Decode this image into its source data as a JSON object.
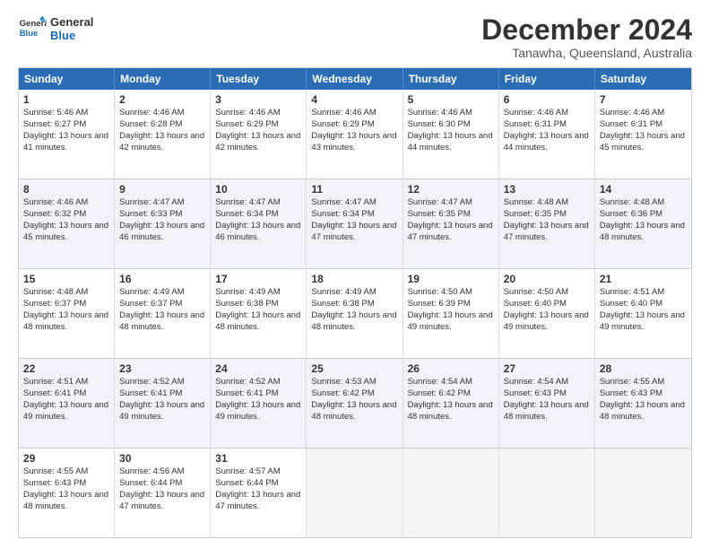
{
  "logo": {
    "line1": "General",
    "line2": "Blue"
  },
  "title": "December 2024",
  "subtitle": "Tanawha, Queensland, Australia",
  "days": [
    "Sunday",
    "Monday",
    "Tuesday",
    "Wednesday",
    "Thursday",
    "Friday",
    "Saturday"
  ],
  "rows": [
    [
      {
        "day": 1,
        "sunrise": "5:46 AM",
        "sunset": "6:27 PM",
        "daylight": "13 hours and 41 minutes."
      },
      {
        "day": 2,
        "sunrise": "4:46 AM",
        "sunset": "6:28 PM",
        "daylight": "13 hours and 42 minutes."
      },
      {
        "day": 3,
        "sunrise": "4:46 AM",
        "sunset": "6:29 PM",
        "daylight": "13 hours and 42 minutes."
      },
      {
        "day": 4,
        "sunrise": "4:46 AM",
        "sunset": "6:29 PM",
        "daylight": "13 hours and 43 minutes."
      },
      {
        "day": 5,
        "sunrise": "4:46 AM",
        "sunset": "6:30 PM",
        "daylight": "13 hours and 44 minutes."
      },
      {
        "day": 6,
        "sunrise": "4:46 AM",
        "sunset": "6:31 PM",
        "daylight": "13 hours and 44 minutes."
      },
      {
        "day": 7,
        "sunrise": "4:46 AM",
        "sunset": "6:31 PM",
        "daylight": "13 hours and 45 minutes."
      }
    ],
    [
      {
        "day": 8,
        "sunrise": "4:46 AM",
        "sunset": "6:32 PM",
        "daylight": "13 hours and 45 minutes."
      },
      {
        "day": 9,
        "sunrise": "4:47 AM",
        "sunset": "6:33 PM",
        "daylight": "13 hours and 46 minutes."
      },
      {
        "day": 10,
        "sunrise": "4:47 AM",
        "sunset": "6:34 PM",
        "daylight": "13 hours and 46 minutes."
      },
      {
        "day": 11,
        "sunrise": "4:47 AM",
        "sunset": "6:34 PM",
        "daylight": "13 hours and 47 minutes."
      },
      {
        "day": 12,
        "sunrise": "4:47 AM",
        "sunset": "6:35 PM",
        "daylight": "13 hours and 47 minutes."
      },
      {
        "day": 13,
        "sunrise": "4:48 AM",
        "sunset": "6:35 PM",
        "daylight": "13 hours and 47 minutes."
      },
      {
        "day": 14,
        "sunrise": "4:48 AM",
        "sunset": "6:36 PM",
        "daylight": "13 hours and 48 minutes."
      }
    ],
    [
      {
        "day": 15,
        "sunrise": "4:48 AM",
        "sunset": "6:37 PM",
        "daylight": "13 hours and 48 minutes."
      },
      {
        "day": 16,
        "sunrise": "4:49 AM",
        "sunset": "6:37 PM",
        "daylight": "13 hours and 48 minutes."
      },
      {
        "day": 17,
        "sunrise": "4:49 AM",
        "sunset": "6:38 PM",
        "daylight": "13 hours and 48 minutes."
      },
      {
        "day": 18,
        "sunrise": "4:49 AM",
        "sunset": "6:38 PM",
        "daylight": "13 hours and 48 minutes."
      },
      {
        "day": 19,
        "sunrise": "4:50 AM",
        "sunset": "6:39 PM",
        "daylight": "13 hours and 49 minutes."
      },
      {
        "day": 20,
        "sunrise": "4:50 AM",
        "sunset": "6:40 PM",
        "daylight": "13 hours and 49 minutes."
      },
      {
        "day": 21,
        "sunrise": "4:51 AM",
        "sunset": "6:40 PM",
        "daylight": "13 hours and 49 minutes."
      }
    ],
    [
      {
        "day": 22,
        "sunrise": "4:51 AM",
        "sunset": "6:41 PM",
        "daylight": "13 hours and 49 minutes."
      },
      {
        "day": 23,
        "sunrise": "4:52 AM",
        "sunset": "6:41 PM",
        "daylight": "13 hours and 49 minutes."
      },
      {
        "day": 24,
        "sunrise": "4:52 AM",
        "sunset": "6:41 PM",
        "daylight": "13 hours and 49 minutes."
      },
      {
        "day": 25,
        "sunrise": "4:53 AM",
        "sunset": "6:42 PM",
        "daylight": "13 hours and 48 minutes."
      },
      {
        "day": 26,
        "sunrise": "4:54 AM",
        "sunset": "6:42 PM",
        "daylight": "13 hours and 48 minutes."
      },
      {
        "day": 27,
        "sunrise": "4:54 AM",
        "sunset": "6:43 PM",
        "daylight": "13 hours and 48 minutes."
      },
      {
        "day": 28,
        "sunrise": "4:55 AM",
        "sunset": "6:43 PM",
        "daylight": "13 hours and 48 minutes."
      }
    ],
    [
      {
        "day": 29,
        "sunrise": "4:55 AM",
        "sunset": "6:43 PM",
        "daylight": "13 hours and 48 minutes."
      },
      {
        "day": 30,
        "sunrise": "4:56 AM",
        "sunset": "6:44 PM",
        "daylight": "13 hours and 47 minutes."
      },
      {
        "day": 31,
        "sunrise": "4:57 AM",
        "sunset": "6:44 PM",
        "daylight": "13 hours and 47 minutes."
      },
      null,
      null,
      null,
      null
    ]
  ]
}
